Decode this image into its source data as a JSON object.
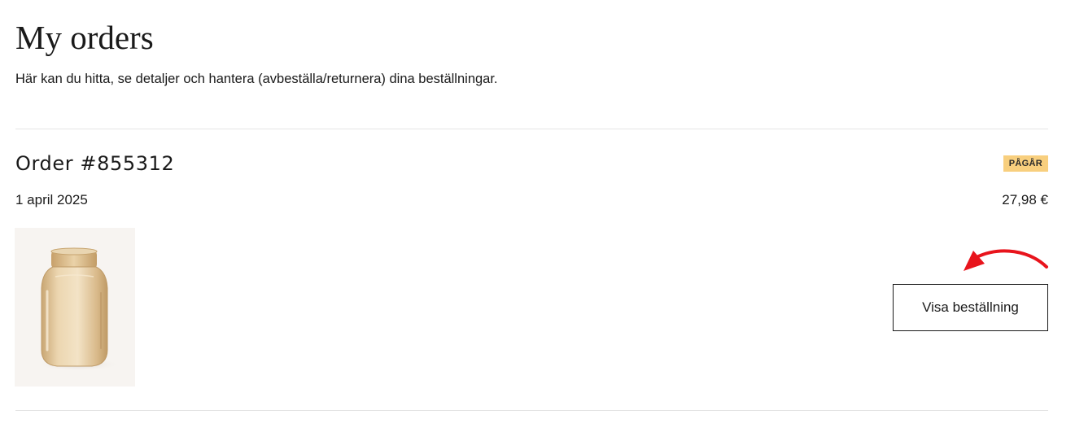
{
  "header": {
    "title": "My orders",
    "subtitle": "Här kan du hitta, se detaljer och hantera (avbeställa/returnera) dina beställningar."
  },
  "orders": [
    {
      "number_label": "Order #855312",
      "status": "PÅGÅR",
      "status_color": "#f8cf7e",
      "date": "1 april 2025",
      "total": "27,98 €",
      "product_image": "amber-glass-vase",
      "button_label": "Visa beställning"
    }
  ],
  "annotation": {
    "arrow_color": "#e8141c",
    "arrow_icon": "curved-arrow-icon"
  }
}
